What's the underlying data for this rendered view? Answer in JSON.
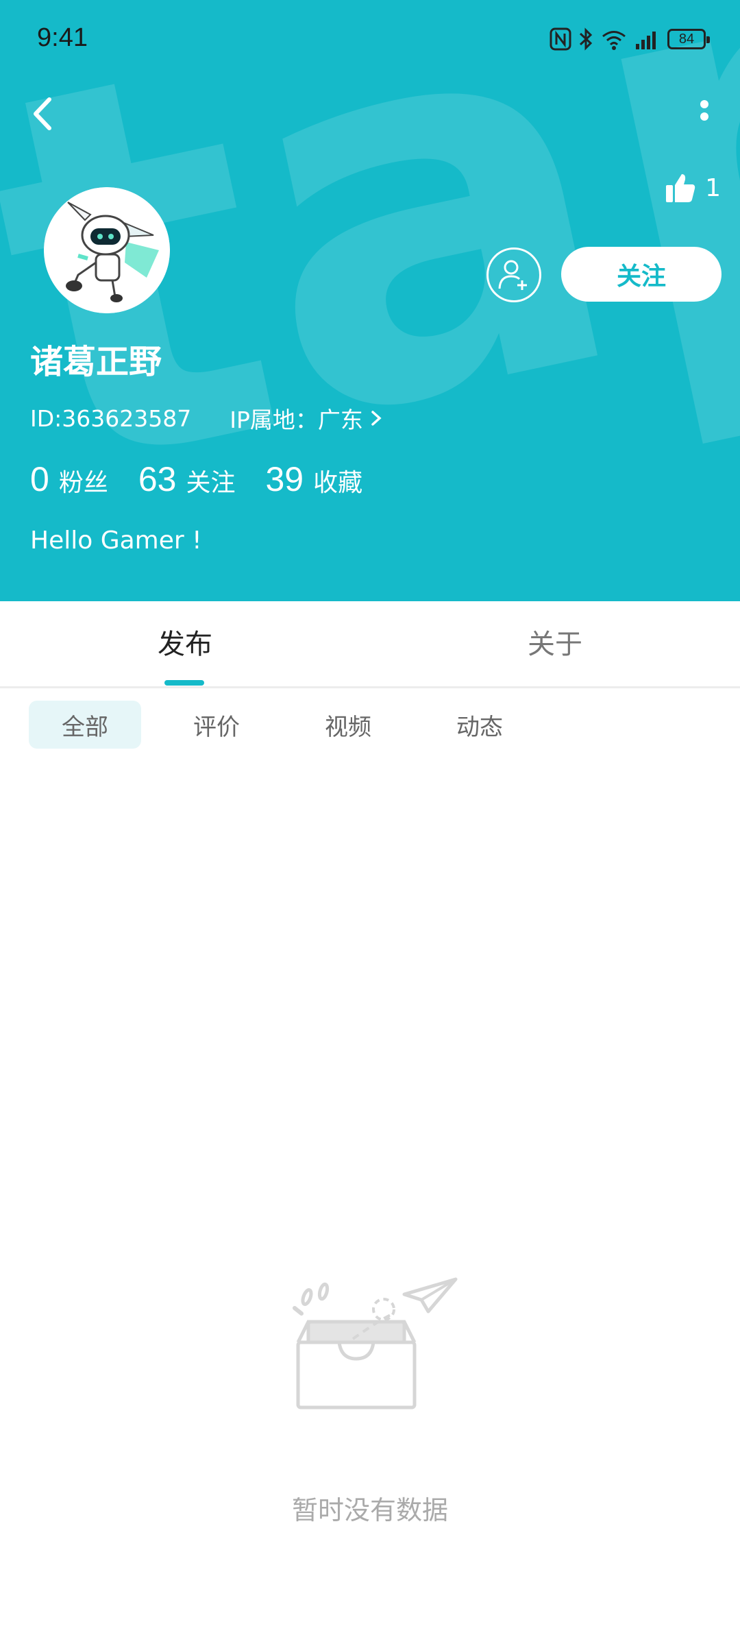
{
  "status_bar": {
    "time": "9:41",
    "battery": "84"
  },
  "header": {
    "watermark_text": "tapTap",
    "like_count": "1",
    "follow_label": "关注",
    "username": "诸葛正野",
    "id_text": "ID:363623587",
    "ip_text": "IP属地：广东",
    "stats": [
      {
        "value": "0",
        "label": "粉丝"
      },
      {
        "value": "63",
        "label": "关注"
      },
      {
        "value": "39",
        "label": "收藏"
      }
    ],
    "bio": "Hello Gamer !"
  },
  "tabs": [
    {
      "label": "发布",
      "active": true
    },
    {
      "label": "关于",
      "active": false
    }
  ],
  "subtabs": [
    {
      "label": "全部",
      "active": true
    },
    {
      "label": "评价",
      "active": false
    },
    {
      "label": "视频",
      "active": false
    },
    {
      "label": "动态",
      "active": false
    }
  ],
  "empty_state": {
    "text": "暂时没有数据"
  },
  "colors": {
    "accent": "#15BAC9",
    "subtab_active_bg": "#E6F6F8"
  }
}
